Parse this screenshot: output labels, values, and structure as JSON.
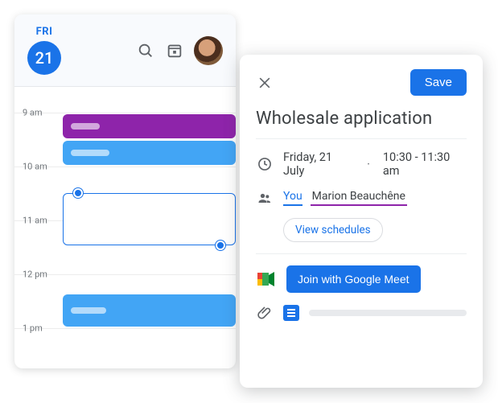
{
  "calendar": {
    "dow": "FRI",
    "date": "21",
    "hours": [
      "9 am",
      "10 am",
      "11 am",
      "12 pm",
      "1 pm"
    ]
  },
  "editor": {
    "save_label": "Save",
    "title": "Wholesale application",
    "date_text": "Friday, 21 July",
    "time_text": "10:30 - 11:30 am",
    "guest_you": "You",
    "guest_other": "Marion Beauchêne",
    "view_schedules": "View schedules",
    "meet_label": "Join with Google Meet"
  }
}
